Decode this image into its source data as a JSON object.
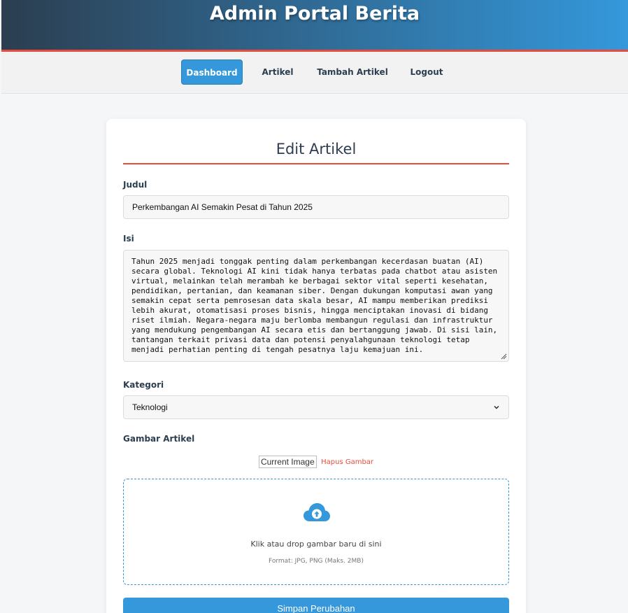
{
  "header": {
    "title": "Admin Portal Berita"
  },
  "nav": {
    "items": [
      {
        "label": "Dashboard",
        "active": true
      },
      {
        "label": "Artikel",
        "active": false
      },
      {
        "label": "Tambah Artikel",
        "active": false
      },
      {
        "label": "Logout",
        "active": false
      }
    ]
  },
  "form": {
    "title": "Edit Artikel",
    "judul": {
      "label": "Judul",
      "value": "Perkembangan AI Semakin Pesat di Tahun 2025"
    },
    "isi": {
      "label": "Isi",
      "value": "Tahun 2025 menjadi tonggak penting dalam perkembangan kecerdasan buatan (AI) secara global. Teknologi AI kini tidak hanya terbatas pada chatbot atau asisten virtual, melainkan telah merambah ke berbagai sektor vital seperti kesehatan, pendidikan, pertanian, dan keamanan siber. Dengan dukungan komputasi awan yang semakin cepat serta pemrosesan data skala besar, AI mampu memberikan prediksi lebih akurat, otomatisasi proses bisnis, hingga menciptakan inovasi di bidang riset ilmiah. Negara-negara maju berlomba membangun regulasi dan infrastruktur yang mendukung pengembangan AI secara etis dan bertanggung jawab. Di sisi lain, tantangan terkait privasi data dan potensi penyalahgunaan teknologi tetap menjadi perhatian penting di tengah pesatnya laju kemajuan ini."
    },
    "kategori": {
      "label": "Kategori",
      "value": "Teknologi"
    },
    "gambar": {
      "label": "Gambar Artikel",
      "current_alt": "Current Image",
      "delete_label": "Hapus Gambar",
      "drop_text": "Klik atau drop gambar baru di sini",
      "drop_hint": "Format: JPG, PNG (Maks. 2MB)"
    },
    "submit_label": "Simpan Perubahan"
  },
  "colors": {
    "primary": "#3498db",
    "accent": "#e74c3c",
    "dark": "#2c3e50"
  },
  "icons": {
    "upload": "cloud-upload-icon",
    "select": "chevron-down-icon",
    "resize": "resize-grip-icon"
  }
}
